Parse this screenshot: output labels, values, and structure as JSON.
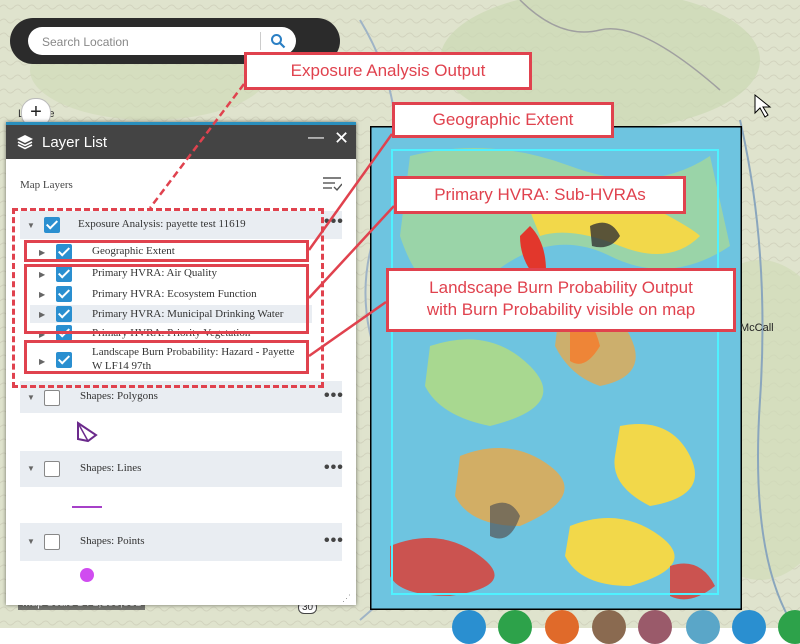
{
  "search": {
    "placeholder": "Search Location"
  },
  "map": {
    "town_label": "L",
    "town_label_rest": "nde",
    "city_label": "McCall",
    "highway": "30",
    "scale_text": "Map Scale 1 : 1,155,581"
  },
  "panel": {
    "title": "Layer List",
    "min_label": "—",
    "close_label": "✕",
    "map_layers_label": "Map Layers",
    "layers": [
      {
        "label": "Exposure Analysis: payette test 11619",
        "checked": true
      },
      {
        "label": "Geographic Extent",
        "checked": true
      },
      {
        "label": "Primary HVRA: Air Quality",
        "checked": true
      },
      {
        "label": "Primary HVRA: Ecosystem Function",
        "checked": true
      },
      {
        "label": "Primary HVRA: Municipal Drinking Water",
        "checked": true
      },
      {
        "label": "Primary HVRA: Priority Vegetation",
        "checked": true
      },
      {
        "label": "Landscape Burn Probability: Hazard - Payette",
        "label2": "W LF14 97th",
        "checked": true
      },
      {
        "label": "Shapes: Polygons",
        "checked": false
      },
      {
        "label": "Shapes: Lines",
        "checked": false
      },
      {
        "label": "Shapes: Points",
        "checked": false
      }
    ]
  },
  "callouts": {
    "exposure": "Exposure Analysis Output",
    "geographic": "Geographic Extent",
    "hvra": "Primary HVRA: Sub-HVRAs",
    "burn_line1": "Landscape Burn Probability Output",
    "burn_line2": "with Burn Probability visible on map"
  },
  "colors": {
    "callout_red": "#e0424e",
    "checkbox_blue": "#2a8fd0",
    "panel_header": "#444444",
    "shape_polygon": "#6b2a8c",
    "shape_line": "#a640c8",
    "shape_point": "#d04cf0"
  }
}
